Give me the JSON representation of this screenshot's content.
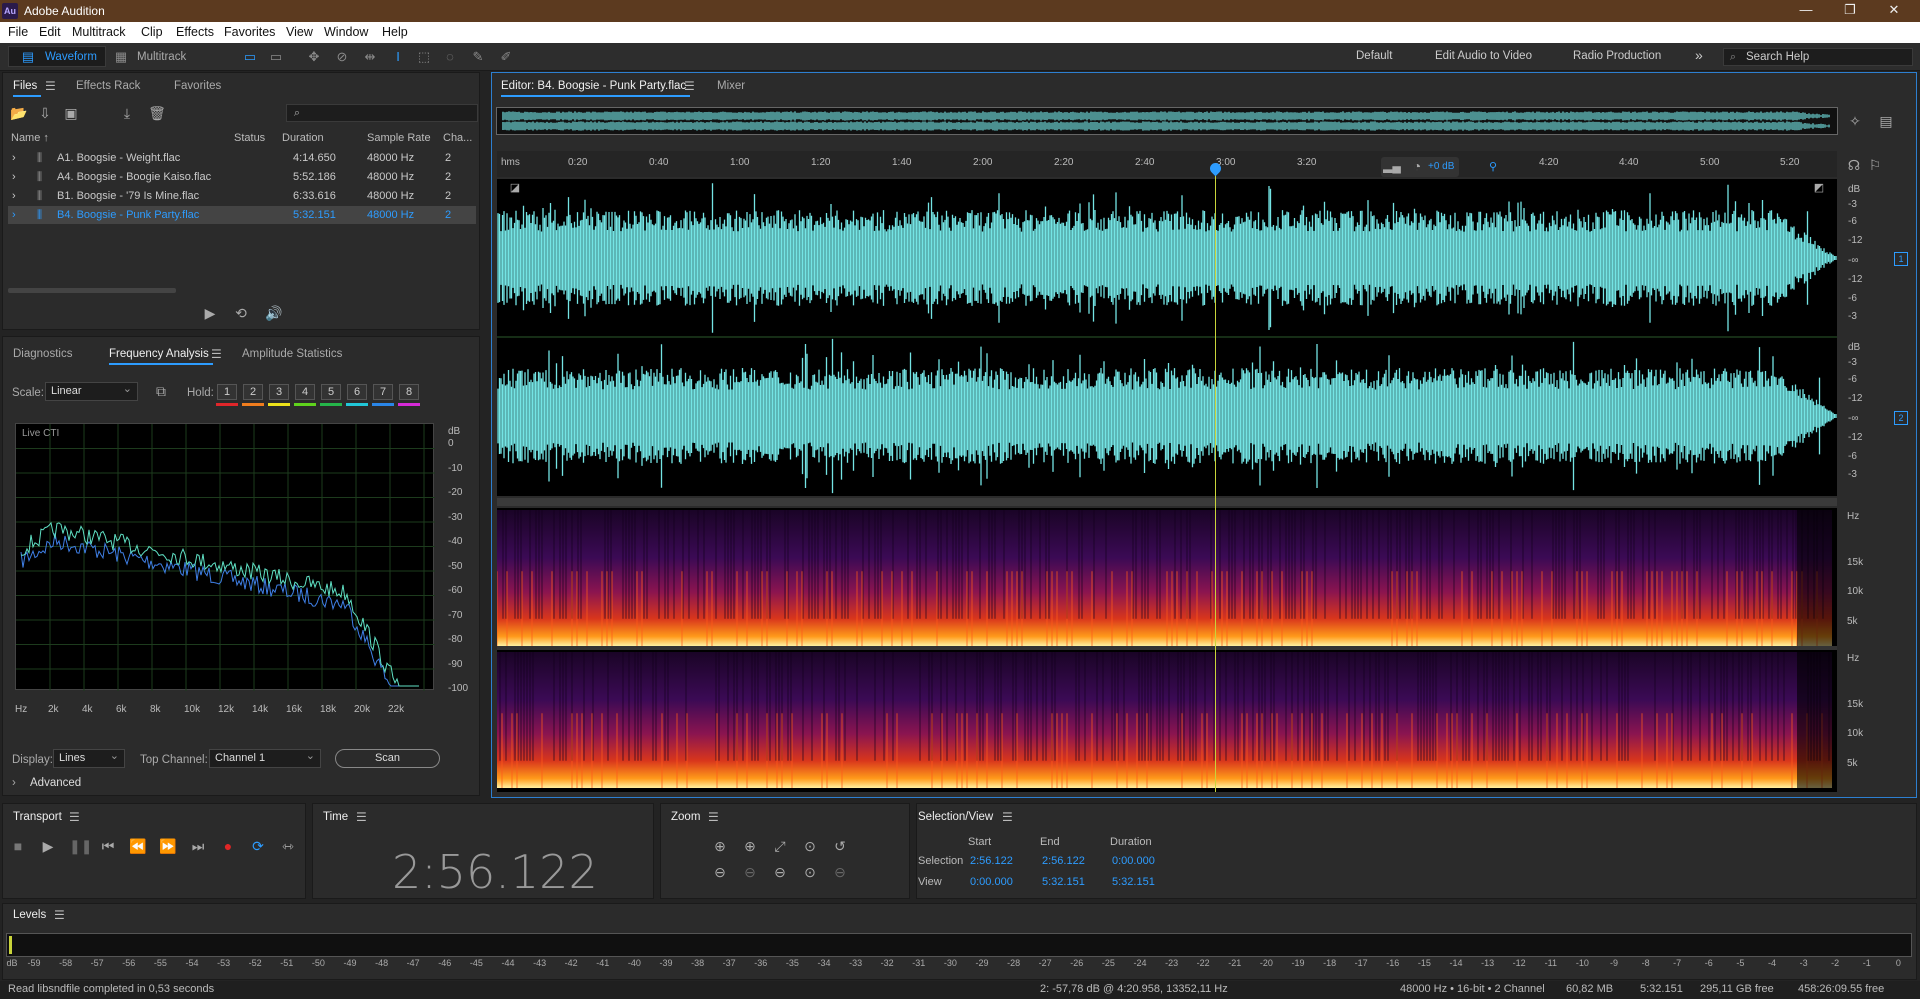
{
  "app": {
    "logo": "Au",
    "title": "Adobe Audition"
  },
  "window_controls": {
    "min": "—",
    "max": "❐",
    "close": "✕"
  },
  "menu": [
    "File",
    "Edit",
    "Multitrack",
    "Clip",
    "Effects",
    "Favorites",
    "View",
    "Window",
    "Help"
  ],
  "toolbar": {
    "waveform": "Waveform",
    "multitrack": "Multitrack"
  },
  "workspaces": [
    "Default",
    "Edit Audio to Video",
    "Radio Production"
  ],
  "workspace_more": "»",
  "search": {
    "placeholder": "Search Help"
  },
  "files_panel": {
    "tabs": [
      "Files",
      "Effects Rack",
      "Favorites"
    ],
    "columns": [
      "Name ↑",
      "Status",
      "Duration",
      "Sample Rate",
      "Cha..."
    ],
    "rows": [
      {
        "name": "A1. Boogsie - Weight.flac",
        "duration": "4:14.650",
        "rate": "48000 Hz",
        "ch": "2"
      },
      {
        "name": "A4. Boogsie - Boogie Kaiso.flac",
        "duration": "5:52.186",
        "rate": "48000 Hz",
        "ch": "2"
      },
      {
        "name": "B1. Boogsie - '79 Is Mine.flac",
        "duration": "6:33.616",
        "rate": "48000 Hz",
        "ch": "2"
      },
      {
        "name": "B4. Boogsie - Punk Party.flac",
        "duration": "5:32.151",
        "rate": "48000 Hz",
        "ch": "2"
      }
    ]
  },
  "analysis_panel": {
    "tabs": [
      "Diagnostics",
      "Frequency Analysis",
      "Amplitude Statistics"
    ],
    "scale_label": "Scale:",
    "scale_value": "Linear",
    "hold_label": "Hold:",
    "holds": [
      "1",
      "2",
      "3",
      "4",
      "5",
      "6",
      "7",
      "8"
    ],
    "hold_colors": [
      "#e0262a",
      "#f07d1e",
      "#ede21a",
      "#5fd21c",
      "#25b54a",
      "#21c7d8",
      "#2a86e8",
      "#d62ad8"
    ],
    "graph_label": "Live CTI",
    "db_ticks": [
      "dB",
      "0",
      "-10",
      "-20",
      "-30",
      "-40",
      "-50",
      "-60",
      "-70",
      "-80",
      "-90",
      "-100"
    ],
    "freq_ticks": [
      "Hz",
      "2k",
      "4k",
      "6k",
      "8k",
      "10k",
      "12k",
      "14k",
      "16k",
      "18k",
      "20k",
      "22k"
    ],
    "display_label": "Display:",
    "display_value": "Lines",
    "top_channel_label": "Top Channel:",
    "top_channel_value": "Channel 1",
    "scan_label": "Scan",
    "advanced_label": "Advanced"
  },
  "editor": {
    "tabs": [
      "Editor: B4. Boogsie - Punk Party.flac",
      "Mixer"
    ],
    "time_ticks": [
      "hms",
      "0:20",
      "0:40",
      "1:00",
      "1:20",
      "1:40",
      "2:00",
      "2:20",
      "2:40",
      "3:00",
      "3:20",
      "4:20",
      "4:40",
      "5:00",
      "5:20"
    ],
    "hud_gain": "+0 dB",
    "wave_db": [
      "dB",
      "-3",
      "-6",
      "-12",
      "-∞",
      "-12",
      "-6",
      "-3"
    ],
    "channel_badges": [
      "1",
      "2"
    ],
    "spec_hz": [
      "Hz",
      "15k",
      "10k",
      "5k"
    ],
    "playhead_fraction": 0.5356
  },
  "transport": {
    "title": "Transport"
  },
  "time_panel": {
    "title": "Time",
    "value": "2:56.122"
  },
  "zoom_panel": {
    "title": "Zoom"
  },
  "selection_view": {
    "title": "Selection/View",
    "headers": [
      "Start",
      "End",
      "Duration"
    ],
    "selection_label": "Selection",
    "selection": [
      "2:56.122",
      "2:56.122",
      "0:00.000"
    ],
    "view_label": "View",
    "view": [
      "0:00.000",
      "5:32.151",
      "5:32.151"
    ]
  },
  "levels": {
    "title": "Levels",
    "ticks": [
      "dB",
      "-59",
      "-58",
      "-57",
      "-56",
      "-55",
      "-54",
      "-53",
      "-52",
      "-51",
      "-50",
      "-49",
      "-48",
      "-47",
      "-46",
      "-45",
      "-44",
      "-43",
      "-42",
      "-41",
      "-40",
      "-39",
      "-38",
      "-37",
      "-36",
      "-35",
      "-34",
      "-33",
      "-32",
      "-31",
      "-30",
      "-29",
      "-28",
      "-27",
      "-26",
      "-25",
      "-24",
      "-23",
      "-22",
      "-21",
      "-20",
      "-19",
      "-18",
      "-17",
      "-16",
      "-15",
      "-14",
      "-13",
      "-12",
      "-11",
      "-10",
      "-9",
      "-8",
      "-7",
      "-6",
      "-5",
      "-4",
      "-3",
      "-2",
      "-1",
      "0"
    ]
  },
  "status": {
    "message": "Read libsndfile completed in 0,53 seconds",
    "cursor": "2: -57,78 dB @ 4:20.958, 13352,11 Hz",
    "format": "48000 Hz • 16-bit • 2 Channel",
    "size": "60,82 MB",
    "duration": "5:32.151",
    "free": "295,11 GB free",
    "free_time": "458:26:09.55 free"
  }
}
